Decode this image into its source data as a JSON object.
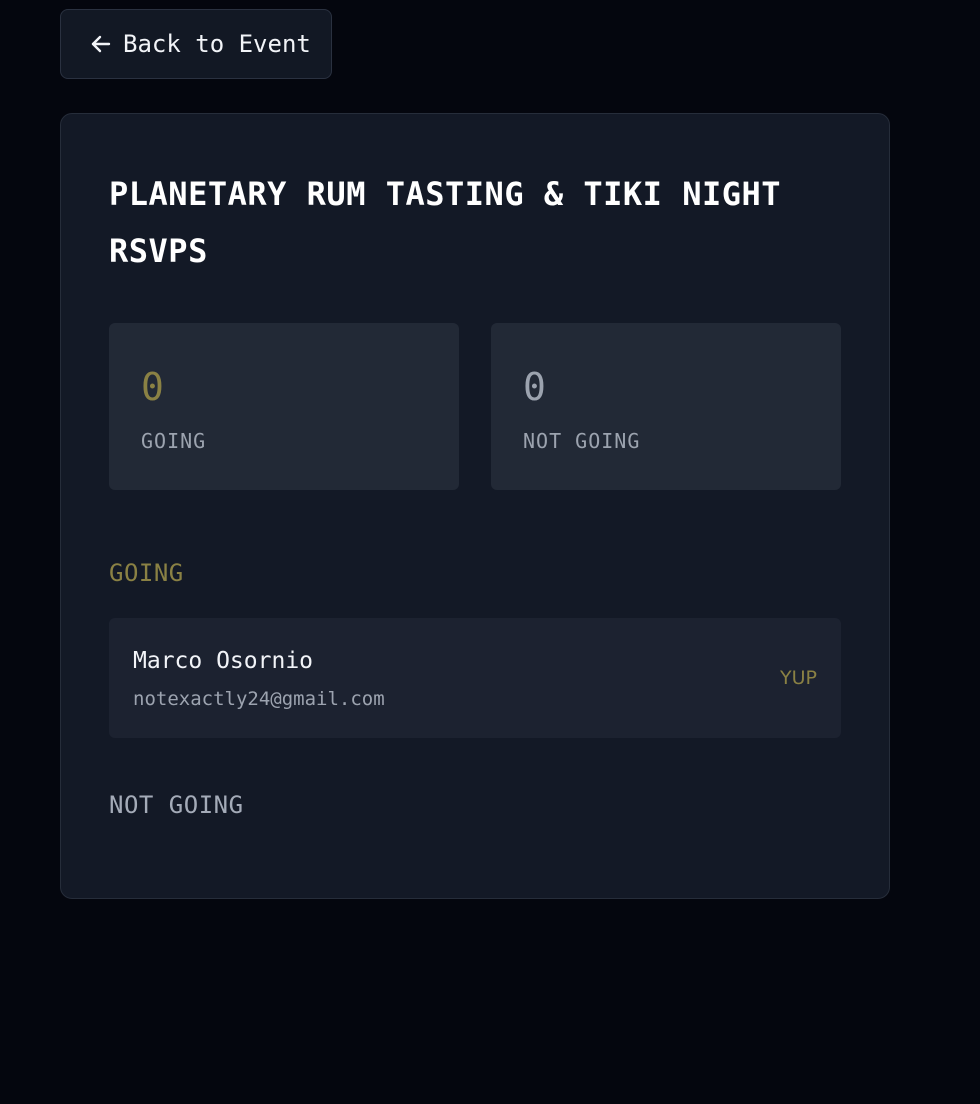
{
  "back_button": {
    "label": "Back to Event",
    "icon": "arrow-left-icon"
  },
  "page": {
    "title": "PLANETARY RUM TASTING & TIKI NIGHT RSVPS"
  },
  "stats": {
    "going": {
      "value": "0",
      "label": "GOING"
    },
    "not_going": {
      "value": "0",
      "label": "NOT GOING"
    }
  },
  "sections": {
    "going": {
      "heading": "GOING",
      "attendees": [
        {
          "name": "Marco Osornio",
          "email": "notexactly24@gmail.com",
          "status": "YUP"
        }
      ]
    },
    "not_going": {
      "heading": "NOT GOING",
      "attendees": []
    }
  },
  "colors": {
    "background": "#04060e",
    "card": "#131926",
    "stat_box": "#222936",
    "row": "#1c2230",
    "accent_olive": "#8a8144",
    "muted_text": "#9ca3af"
  }
}
